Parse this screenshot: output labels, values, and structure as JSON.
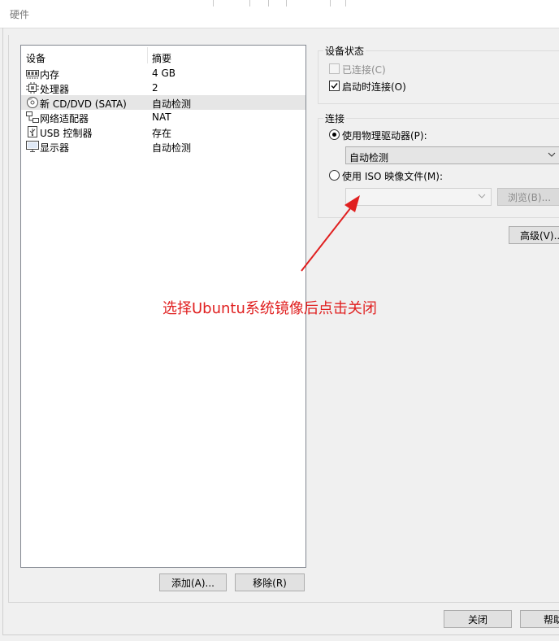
{
  "window": {
    "title": "硬件"
  },
  "device_list": {
    "header": {
      "device": "设备",
      "summary": "摘要"
    },
    "items": [
      {
        "icon": "memory-icon",
        "name": "内存",
        "summary": "4 GB"
      },
      {
        "icon": "processor-icon",
        "name": "处理器",
        "summary": "2"
      },
      {
        "icon": "cd-dvd-icon",
        "name": "新 CD/DVD (SATA)",
        "summary": "自动检测",
        "selected": true
      },
      {
        "icon": "network-adapter-icon",
        "name": "网络适配器",
        "summary": "NAT"
      },
      {
        "icon": "usb-controller-icon",
        "name": "USB 控制器",
        "summary": "存在"
      },
      {
        "icon": "display-icon",
        "name": "显示器",
        "summary": "自动检测"
      }
    ],
    "add_button": "添加(A)...",
    "remove_button": "移除(R)"
  },
  "device_status": {
    "title": "设备状态",
    "connected": {
      "label": "已连接(C)",
      "checked": false,
      "disabled": true
    },
    "connect_at_power_on": {
      "label": "启动时连接(O)",
      "checked": true
    }
  },
  "connection": {
    "title": "连接",
    "physical_drive": {
      "label": "使用物理驱动器(P):",
      "selected": true,
      "value": "自动检测"
    },
    "iso_image": {
      "label": "使用 ISO 映像文件(M):",
      "selected": false,
      "value": ""
    },
    "browse_button": "浏览(B)..."
  },
  "advanced_button": "高级(V)...",
  "footer": {
    "close_button": "关闭",
    "help_button": "帮助"
  },
  "annotation": {
    "text": "选择Ubuntu系统镜像后点击关闭",
    "color": "#e02020"
  }
}
